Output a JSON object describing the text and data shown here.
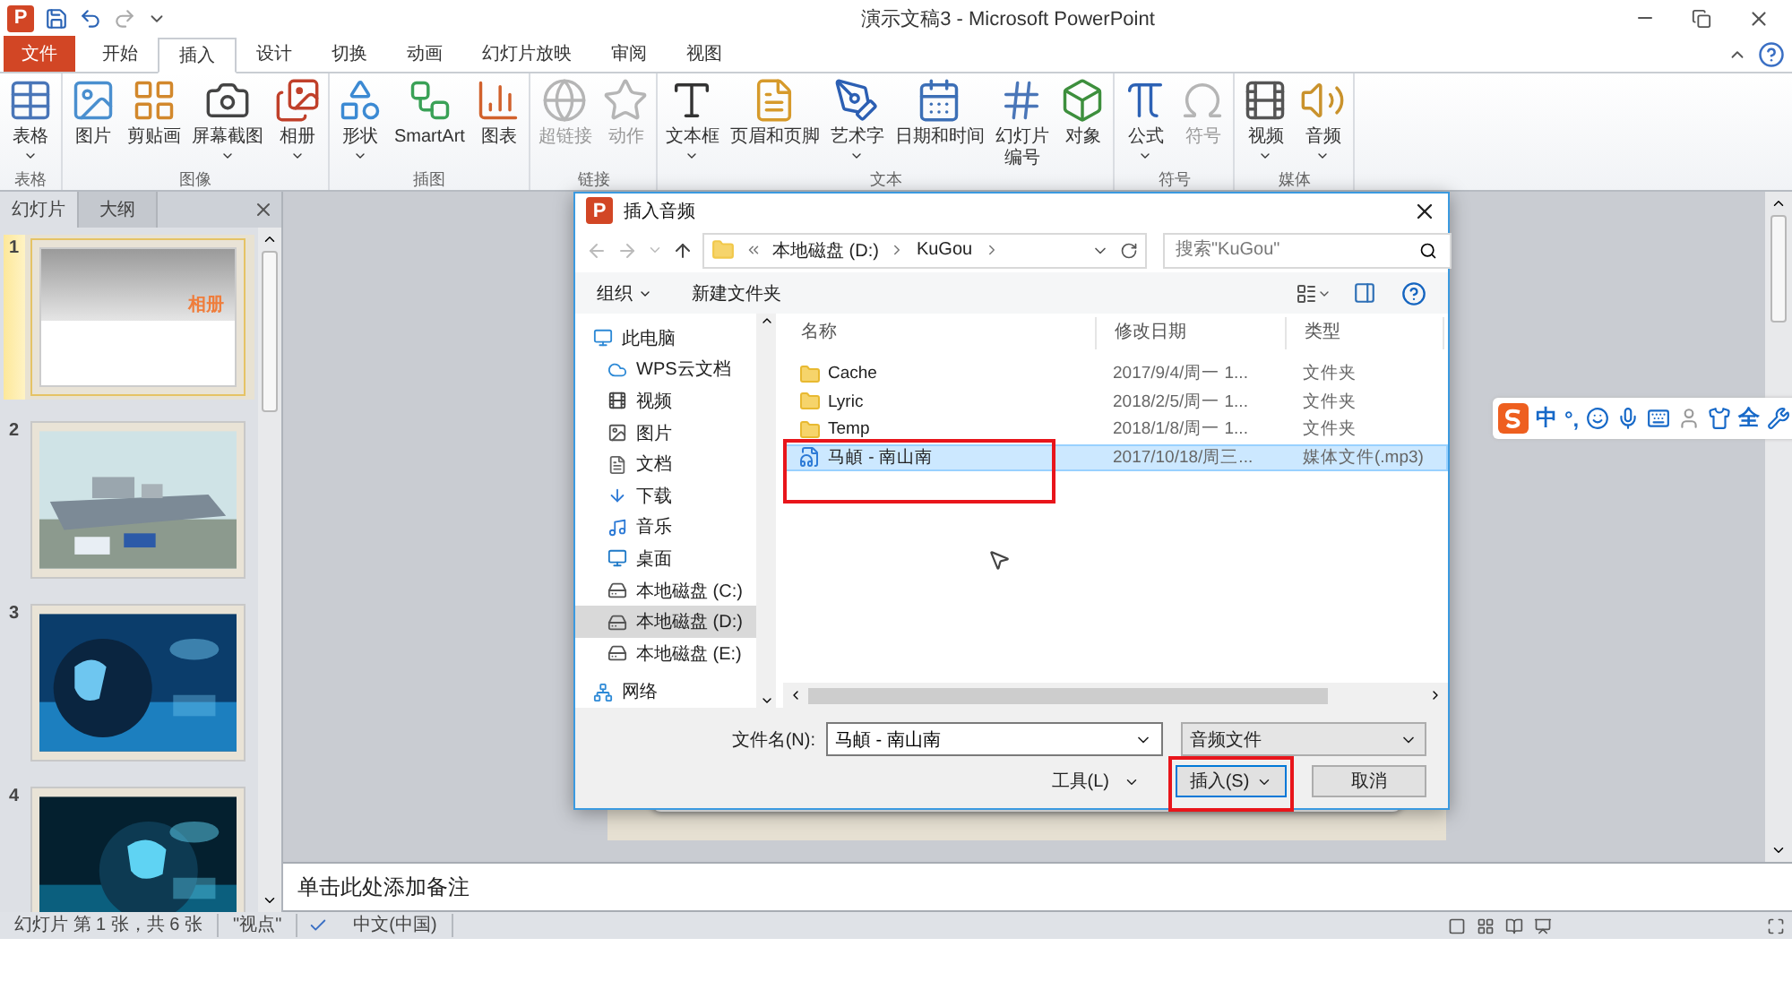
{
  "app": {
    "logo": "P",
    "title": "演示文稿3  -  Microsoft PowerPoint"
  },
  "ribbon_tabs": [
    {
      "label": "文件",
      "kind": "file",
      "selected": false
    },
    {
      "label": "开始",
      "kind": "tab",
      "selected": false
    },
    {
      "label": "插入",
      "kind": "tab",
      "selected": true
    },
    {
      "label": "设计",
      "kind": "tab",
      "selected": false
    },
    {
      "label": "切换",
      "kind": "tab",
      "selected": false
    },
    {
      "label": "动画",
      "kind": "tab",
      "selected": false
    },
    {
      "label": "幻灯片放映",
      "kind": "tab",
      "selected": false
    },
    {
      "label": "审阅",
      "kind": "tab",
      "selected": false
    },
    {
      "label": "视图",
      "kind": "tab",
      "selected": false
    }
  ],
  "ribbon_groups": [
    {
      "label": "表格",
      "buttons": [
        {
          "label": "表格",
          "dropdown": true,
          "disabled": false
        }
      ]
    },
    {
      "label": "图像",
      "buttons": [
        {
          "label": "图片",
          "dropdown": false,
          "disabled": false
        },
        {
          "label": "剪贴画",
          "dropdown": false,
          "disabled": false
        },
        {
          "label": "屏幕截图",
          "dropdown": true,
          "disabled": false
        },
        {
          "label": "相册",
          "dropdown": true,
          "disabled": false
        }
      ]
    },
    {
      "label": "插图",
      "buttons": [
        {
          "label": "形状",
          "dropdown": true,
          "disabled": false
        },
        {
          "label": "SmartArt",
          "dropdown": false,
          "disabled": false
        },
        {
          "label": "图表",
          "dropdown": false,
          "disabled": false
        }
      ]
    },
    {
      "label": "链接",
      "buttons": [
        {
          "label": "超链接",
          "dropdown": false,
          "disabled": true
        },
        {
          "label": "动作",
          "dropdown": false,
          "disabled": true
        }
      ]
    },
    {
      "label": "文本",
      "buttons": [
        {
          "label": "文本框",
          "dropdown": true,
          "disabled": false
        },
        {
          "label": "页眉和页脚",
          "dropdown": false,
          "disabled": false
        },
        {
          "label": "艺术字",
          "dropdown": true,
          "disabled": false
        },
        {
          "label": "日期和时间",
          "dropdown": false,
          "disabled": false
        },
        {
          "label": "幻灯片",
          "label_2": "编号",
          "dropdown": false,
          "disabled": false
        },
        {
          "label": "对象",
          "dropdown": false,
          "disabled": false
        }
      ]
    },
    {
      "label": "符号",
      "buttons": [
        {
          "label": "公式",
          "dropdown": true,
          "disabled": false
        },
        {
          "label": "符号",
          "dropdown": false,
          "disabled": true
        }
      ]
    },
    {
      "label": "媒体",
      "buttons": [
        {
          "label": "视频",
          "dropdown": true,
          "disabled": false
        },
        {
          "label": "音频",
          "dropdown": true,
          "disabled": false
        }
      ]
    }
  ],
  "slides_panel": {
    "tabs": [
      {
        "label": "幻灯片",
        "selected": true
      },
      {
        "label": "大纲",
        "selected": false
      }
    ],
    "slides": [
      {
        "number": "1",
        "kind": "title",
        "title": "相册",
        "selected": true
      },
      {
        "number": "2",
        "kind": "picture",
        "selected": false
      },
      {
        "number": "3",
        "kind": "picture",
        "selected": false
      },
      {
        "number": "4",
        "kind": "picture",
        "selected": false
      }
    ]
  },
  "notes": {
    "text": "单击此处添加备注"
  },
  "status_bar": {
    "slide_info": "幻灯片 第 1 张，共 6 张",
    "theme": "\"视点\"",
    "language": "中文(中国)"
  },
  "dialog": {
    "logo": "P",
    "title": "插入音频",
    "path": [
      "本地磁盘 (D:)",
      "KuGou"
    ],
    "search": {
      "placeholder": "搜索\"KuGou\""
    },
    "organize": "组织",
    "new_folder": "新建文件夹",
    "nav": [
      {
        "label": "此电脑",
        "selected": false,
        "children": [
          {
            "label": "WPS云文档",
            "selected": false
          },
          {
            "label": "视频",
            "selected": false
          },
          {
            "label": "图片",
            "selected": false
          },
          {
            "label": "文档",
            "selected": false
          },
          {
            "label": "下载",
            "selected": false
          },
          {
            "label": "音乐",
            "selected": false
          },
          {
            "label": "桌面",
            "selected": false
          },
          {
            "label": "本地磁盘 (C:)",
            "selected": false
          },
          {
            "label": "本地磁盘 (D:)",
            "selected": true
          },
          {
            "label": "本地磁盘 (E:)",
            "selected": false
          }
        ]
      },
      {
        "label": "网络",
        "selected": false
      }
    ],
    "columns": [
      "名称",
      "修改日期",
      "类型"
    ],
    "files": [
      {
        "name": "Cache",
        "modified": "2017/9/4/周一 1...",
        "type": "文件夹",
        "kind": "folder",
        "selected": false,
        "highlighted": false
      },
      {
        "name": "Lyric",
        "modified": "2018/2/5/周一 1...",
        "type": "文件夹",
        "kind": "folder",
        "selected": false,
        "highlighted": false
      },
      {
        "name": "Temp",
        "modified": "2018/1/8/周一 1...",
        "type": "文件夹",
        "kind": "folder",
        "selected": false,
        "highlighted": false
      },
      {
        "name": "马頔 - 南山南",
        "modified": "2017/10/18/周三...",
        "type": "媒体文件(.mp3)",
        "kind": "audio",
        "selected": true,
        "highlighted": true
      }
    ],
    "filename": {
      "label": "文件名(N):",
      "value": "马頔 - 南山南"
    },
    "filetype": "音频文件",
    "tools": "工具(L)",
    "insert": {
      "label": "插入(S)",
      "highlighted": true
    },
    "cancel": "取消"
  },
  "ime_toolbar": {
    "mode": "中",
    "punctuation": "°,",
    "width": "全"
  }
}
